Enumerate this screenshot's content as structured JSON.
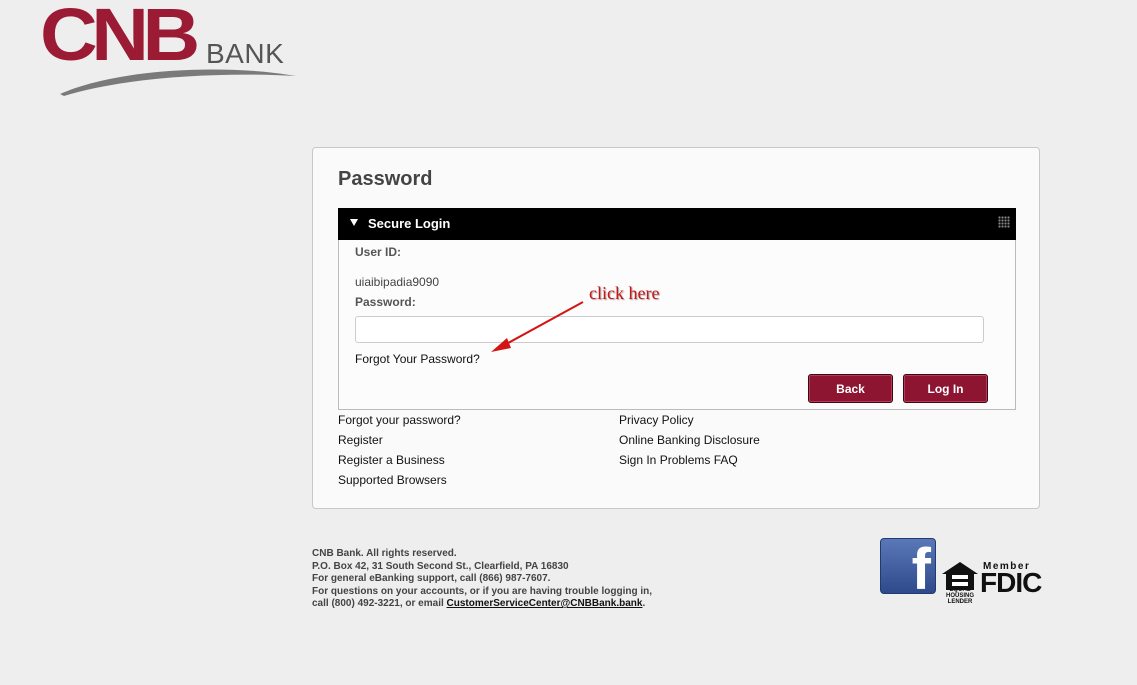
{
  "brand": {
    "logo_main": "CNB",
    "logo_sub": "BANK",
    "primary_color": "#9b1b34",
    "button_color": "#8e1531"
  },
  "page": {
    "title": "Password"
  },
  "panel": {
    "header": "Secure Login",
    "user_id_label": "User ID:",
    "user_id_value": "uiaibipadia9090",
    "password_label": "Password:",
    "password_value": "",
    "forgot_link": "Forgot Your Password?",
    "back_button": "Back",
    "login_button": "Log In"
  },
  "annotation": {
    "text": "click here",
    "color": "#c81414"
  },
  "links_left": [
    "Forgot your password?",
    "Register",
    "Register a Business",
    "Supported Browsers"
  ],
  "links_right": [
    "Privacy Policy",
    "Online Banking Disclosure",
    "Sign In Problems FAQ"
  ],
  "footer": {
    "line1": "CNB Bank. All rights reserved.",
    "line2": "P.O. Box 42, 31 South Second St., Clearfield, PA 16830",
    "line3": "For general eBanking support, call (866) 987-7607.",
    "line4": "For questions on your accounts, or if you are having trouble logging in,",
    "line5_prefix": "call (800) 492-3221, or email ",
    "email": "CustomerServiceCenter@CNBBank.bank",
    "line5_suffix": "."
  },
  "badges": {
    "facebook": "f",
    "eho_line1": "EQUAL HOUSING",
    "eho_line2": "LENDER",
    "fdic_member": "Member",
    "fdic": "FDIC"
  }
}
